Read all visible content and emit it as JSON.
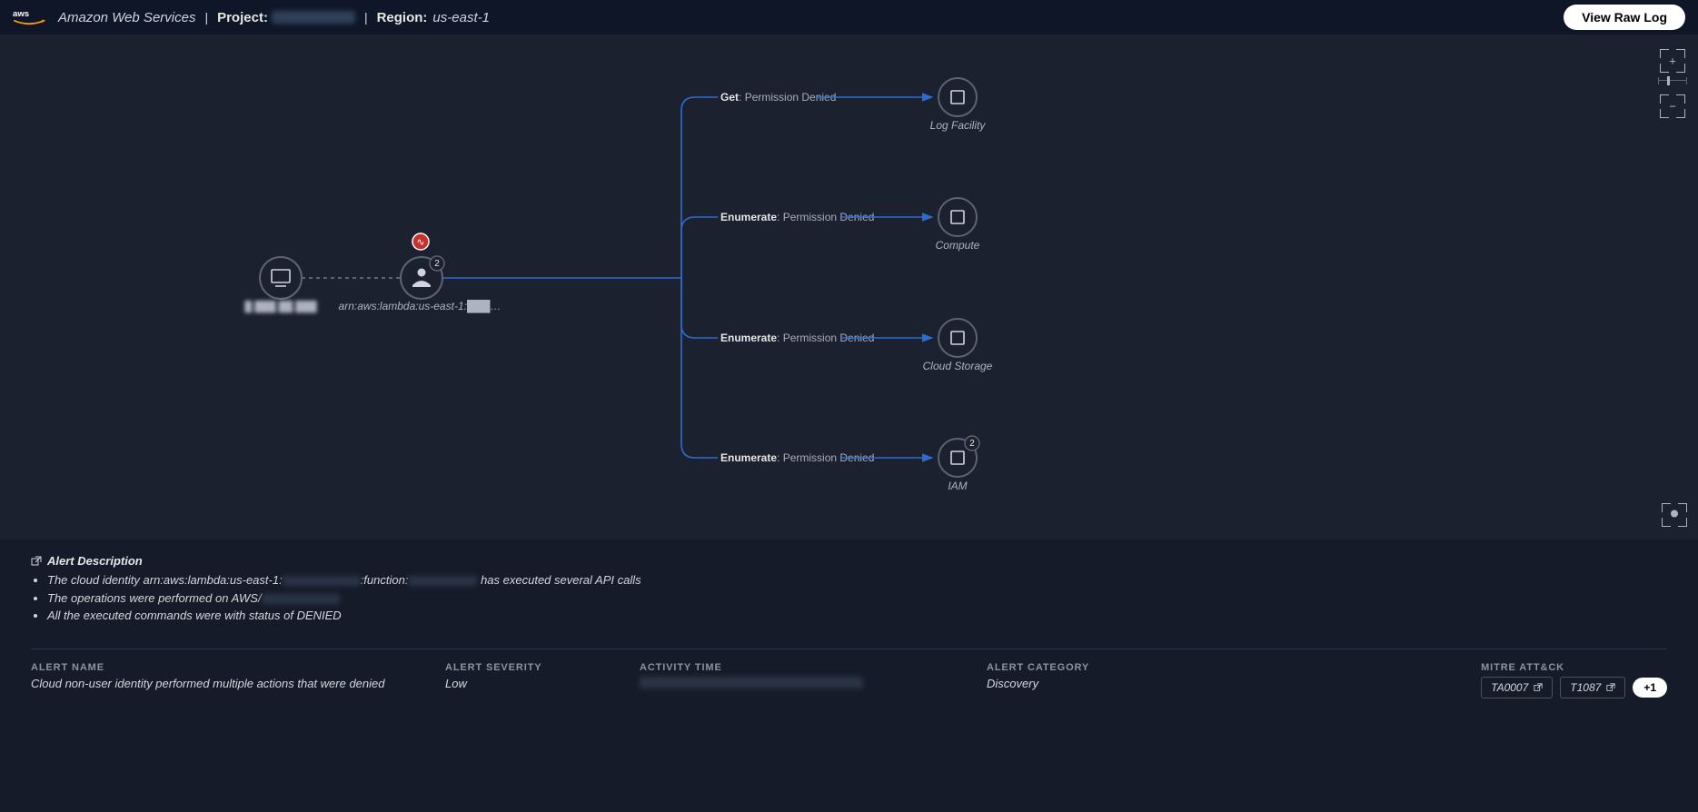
{
  "header": {
    "provider": "Amazon Web Services",
    "project_label": "Project:",
    "project_value": "████████████",
    "region_label": "Region:",
    "region_value": "us-east-1",
    "view_raw_log": "View Raw Log"
  },
  "graph": {
    "source_node": {
      "label": "█.███.██.███",
      "type": "host"
    },
    "identity_node": {
      "label": "arn:aws:lambda:us-east-1:███…",
      "badge": "2",
      "alert": true
    },
    "targets": [
      {
        "op": "Get",
        "status": "Permission Denied",
        "name": "Log Facility",
        "badge": null
      },
      {
        "op": "Enumerate",
        "status": "Permission Denied",
        "name": "Compute",
        "badge": null
      },
      {
        "op": "Enumerate",
        "status": "Permission Denied",
        "name": "Cloud Storage",
        "badge": null
      },
      {
        "op": "Enumerate",
        "status": "Permission Denied",
        "name": "IAM",
        "badge": "2"
      }
    ]
  },
  "description": {
    "title": "Alert Description",
    "bullets": [
      {
        "pre": "The cloud identity arn:aws:lambda:us-east-1:",
        "mid_redact_w": 86,
        "mid2": ":function:",
        "mid_redact2_w": 76,
        "post": " has executed several API calls"
      },
      {
        "pre": "The operations were performed on AWS/",
        "mid_redact_w": 86,
        "mid2": "",
        "mid_redact2_w": 0,
        "post": ""
      },
      {
        "pre": "All the executed commands were with status of DENIED",
        "mid_redact_w": 0,
        "mid2": "",
        "mid_redact2_w": 0,
        "post": ""
      }
    ]
  },
  "footer": {
    "alert_name_label": "ALERT NAME",
    "alert_name_value": "Cloud non-user identity performed multiple actions that were denied",
    "severity_label": "ALERT SEVERITY",
    "severity_value": "Low",
    "activity_time_label": "ACTIVITY TIME",
    "category_label": "ALERT CATEGORY",
    "category_value": "Discovery",
    "mitre_label": "MITRE ATT&CK",
    "mitre_tags": [
      "TA0007",
      "T1087"
    ],
    "mitre_more": "+1"
  }
}
